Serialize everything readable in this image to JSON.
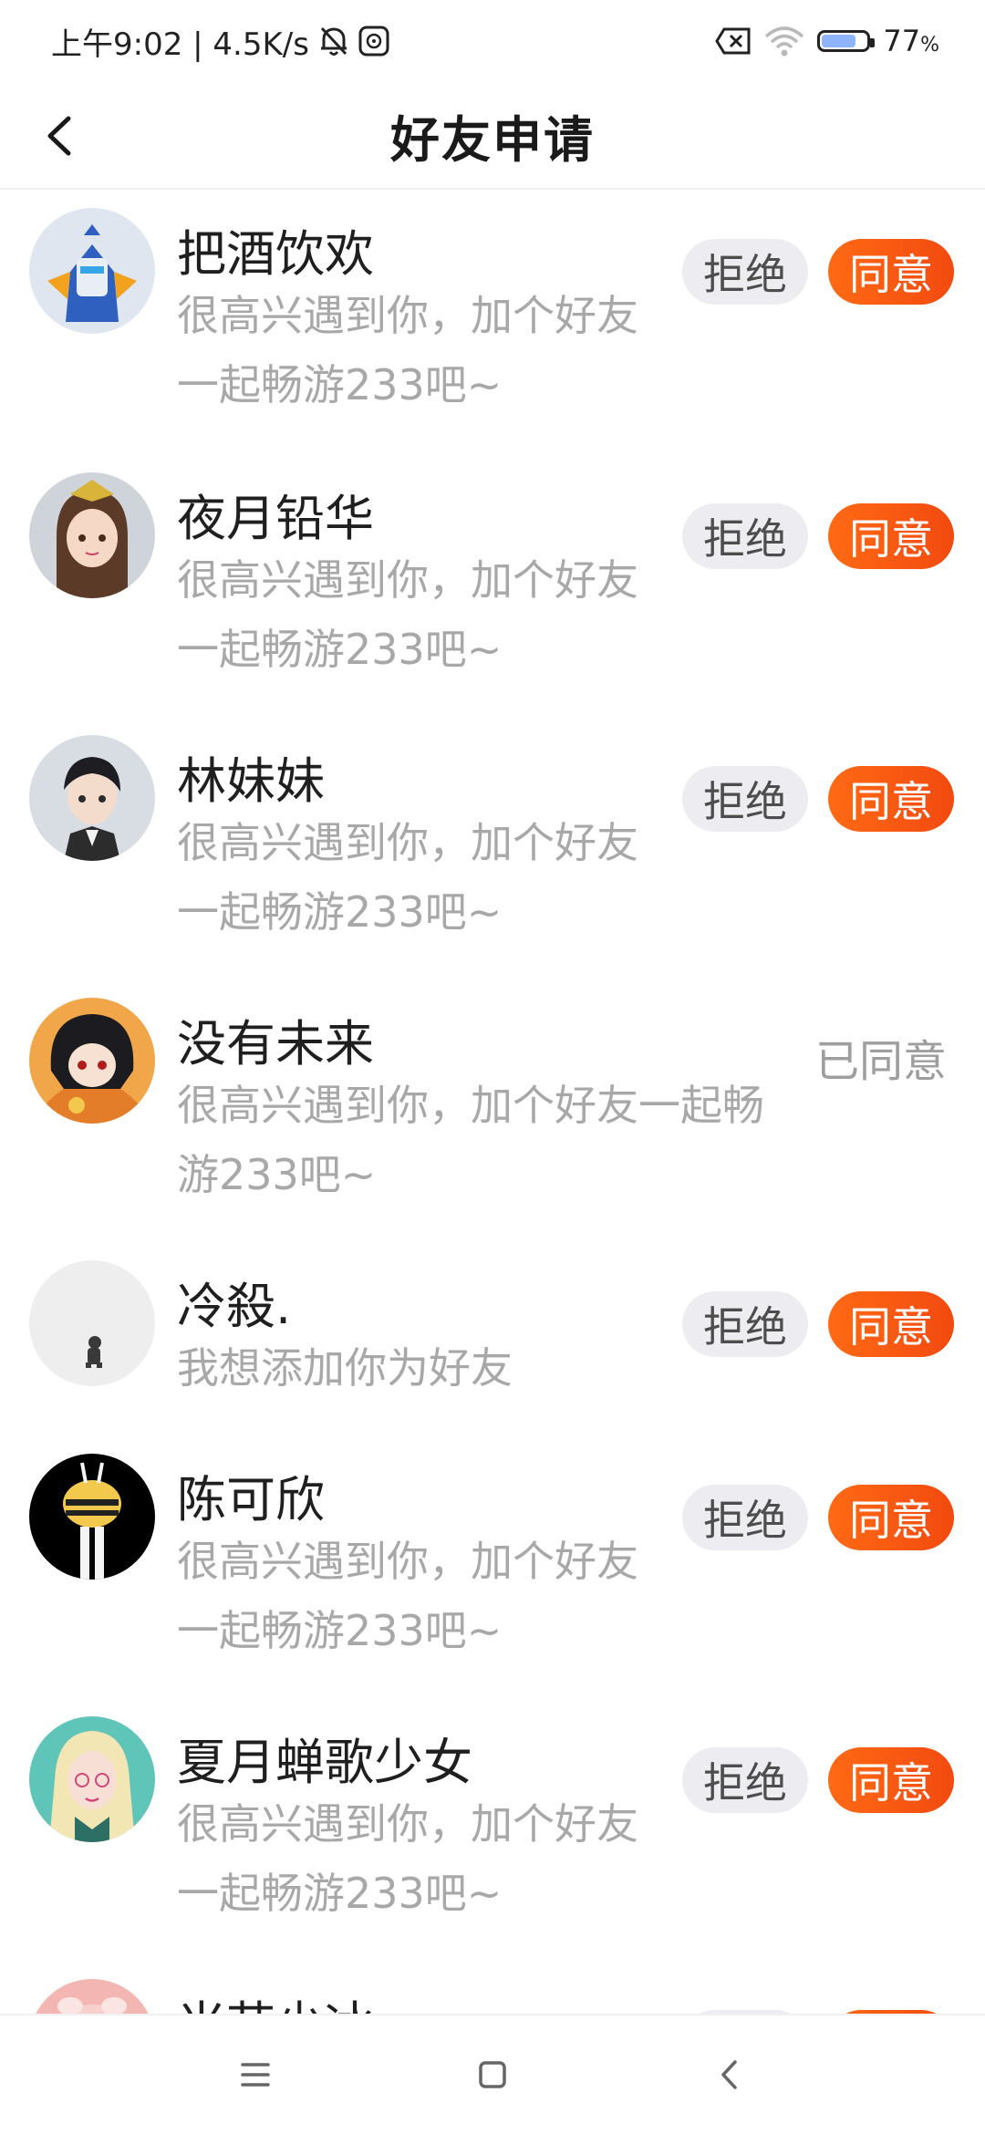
{
  "status_bar": {
    "time_speed": "上午9:02 | 4.5K/s",
    "battery": "77",
    "battery_unit": "%",
    "battery_level": 0.77,
    "icons": [
      "mute-bell-icon",
      "app-notification-icon",
      "sim-off-icon",
      "wifi-icon",
      "battery-icon"
    ]
  },
  "header": {
    "title": "好友申请",
    "back_icon": "chevron-left-icon"
  },
  "requests": [
    {
      "name": "把酒饮欢",
      "message": [
        "很高兴遇到你，加个好友",
        "一起畅游233吧~"
      ],
      "state": "pending",
      "reject_label": "拒绝",
      "agree_label": "同意",
      "avatar": "robot-avatar"
    },
    {
      "name": "夜月铅华",
      "message": [
        "很高兴遇到你，加个好友",
        "一起畅游233吧~"
      ],
      "state": "pending",
      "reject_label": "拒绝",
      "agree_label": "同意",
      "avatar": "anime-girl-avatar"
    },
    {
      "name": "林妹妹",
      "message": [
        "很高兴遇到你，加个好友",
        "一起畅游233吧~"
      ],
      "state": "pending",
      "reject_label": "拒绝",
      "agree_label": "同意",
      "avatar": "anime-boy-avatar"
    },
    {
      "name": "没有未来",
      "message": [
        "很高兴遇到你，加个好友一起畅",
        "游233吧~"
      ],
      "state": "agreed",
      "agreed_label": "已同意",
      "avatar": "dark-hair-avatar"
    },
    {
      "name": "冷殺.",
      "message": [
        "我想添加你为好友"
      ],
      "state": "pending",
      "reject_label": "拒绝",
      "agree_label": "同意",
      "avatar": "small-figure-avatar"
    },
    {
      "name": "陈可欣",
      "message": [
        "很高兴遇到你，加个好友",
        "一起畅游233吧~"
      ],
      "state": "pending",
      "reject_label": "拒绝",
      "agree_label": "同意",
      "avatar": "bee-costume-avatar"
    },
    {
      "name": "夏月蝉歌少女",
      "message": [
        "很高兴遇到你，加个好友",
        "一起畅游233吧~"
      ],
      "state": "pending",
      "reject_label": "拒绝",
      "agree_label": "同意",
      "avatar": "blonde-girl-avatar"
    },
    {
      "name": "米苗少冰",
      "message": [],
      "state": "pending",
      "reject_label": "拒绝",
      "agree_label": "同意",
      "avatar": "pink-avatar"
    }
  ],
  "nav": {
    "icons": [
      "menu-icon",
      "home-icon",
      "back-icon"
    ]
  },
  "colors": {
    "accent": "#f55a12",
    "reject_bg": "#ececf1",
    "secondary_text": "#a8a8a8"
  }
}
